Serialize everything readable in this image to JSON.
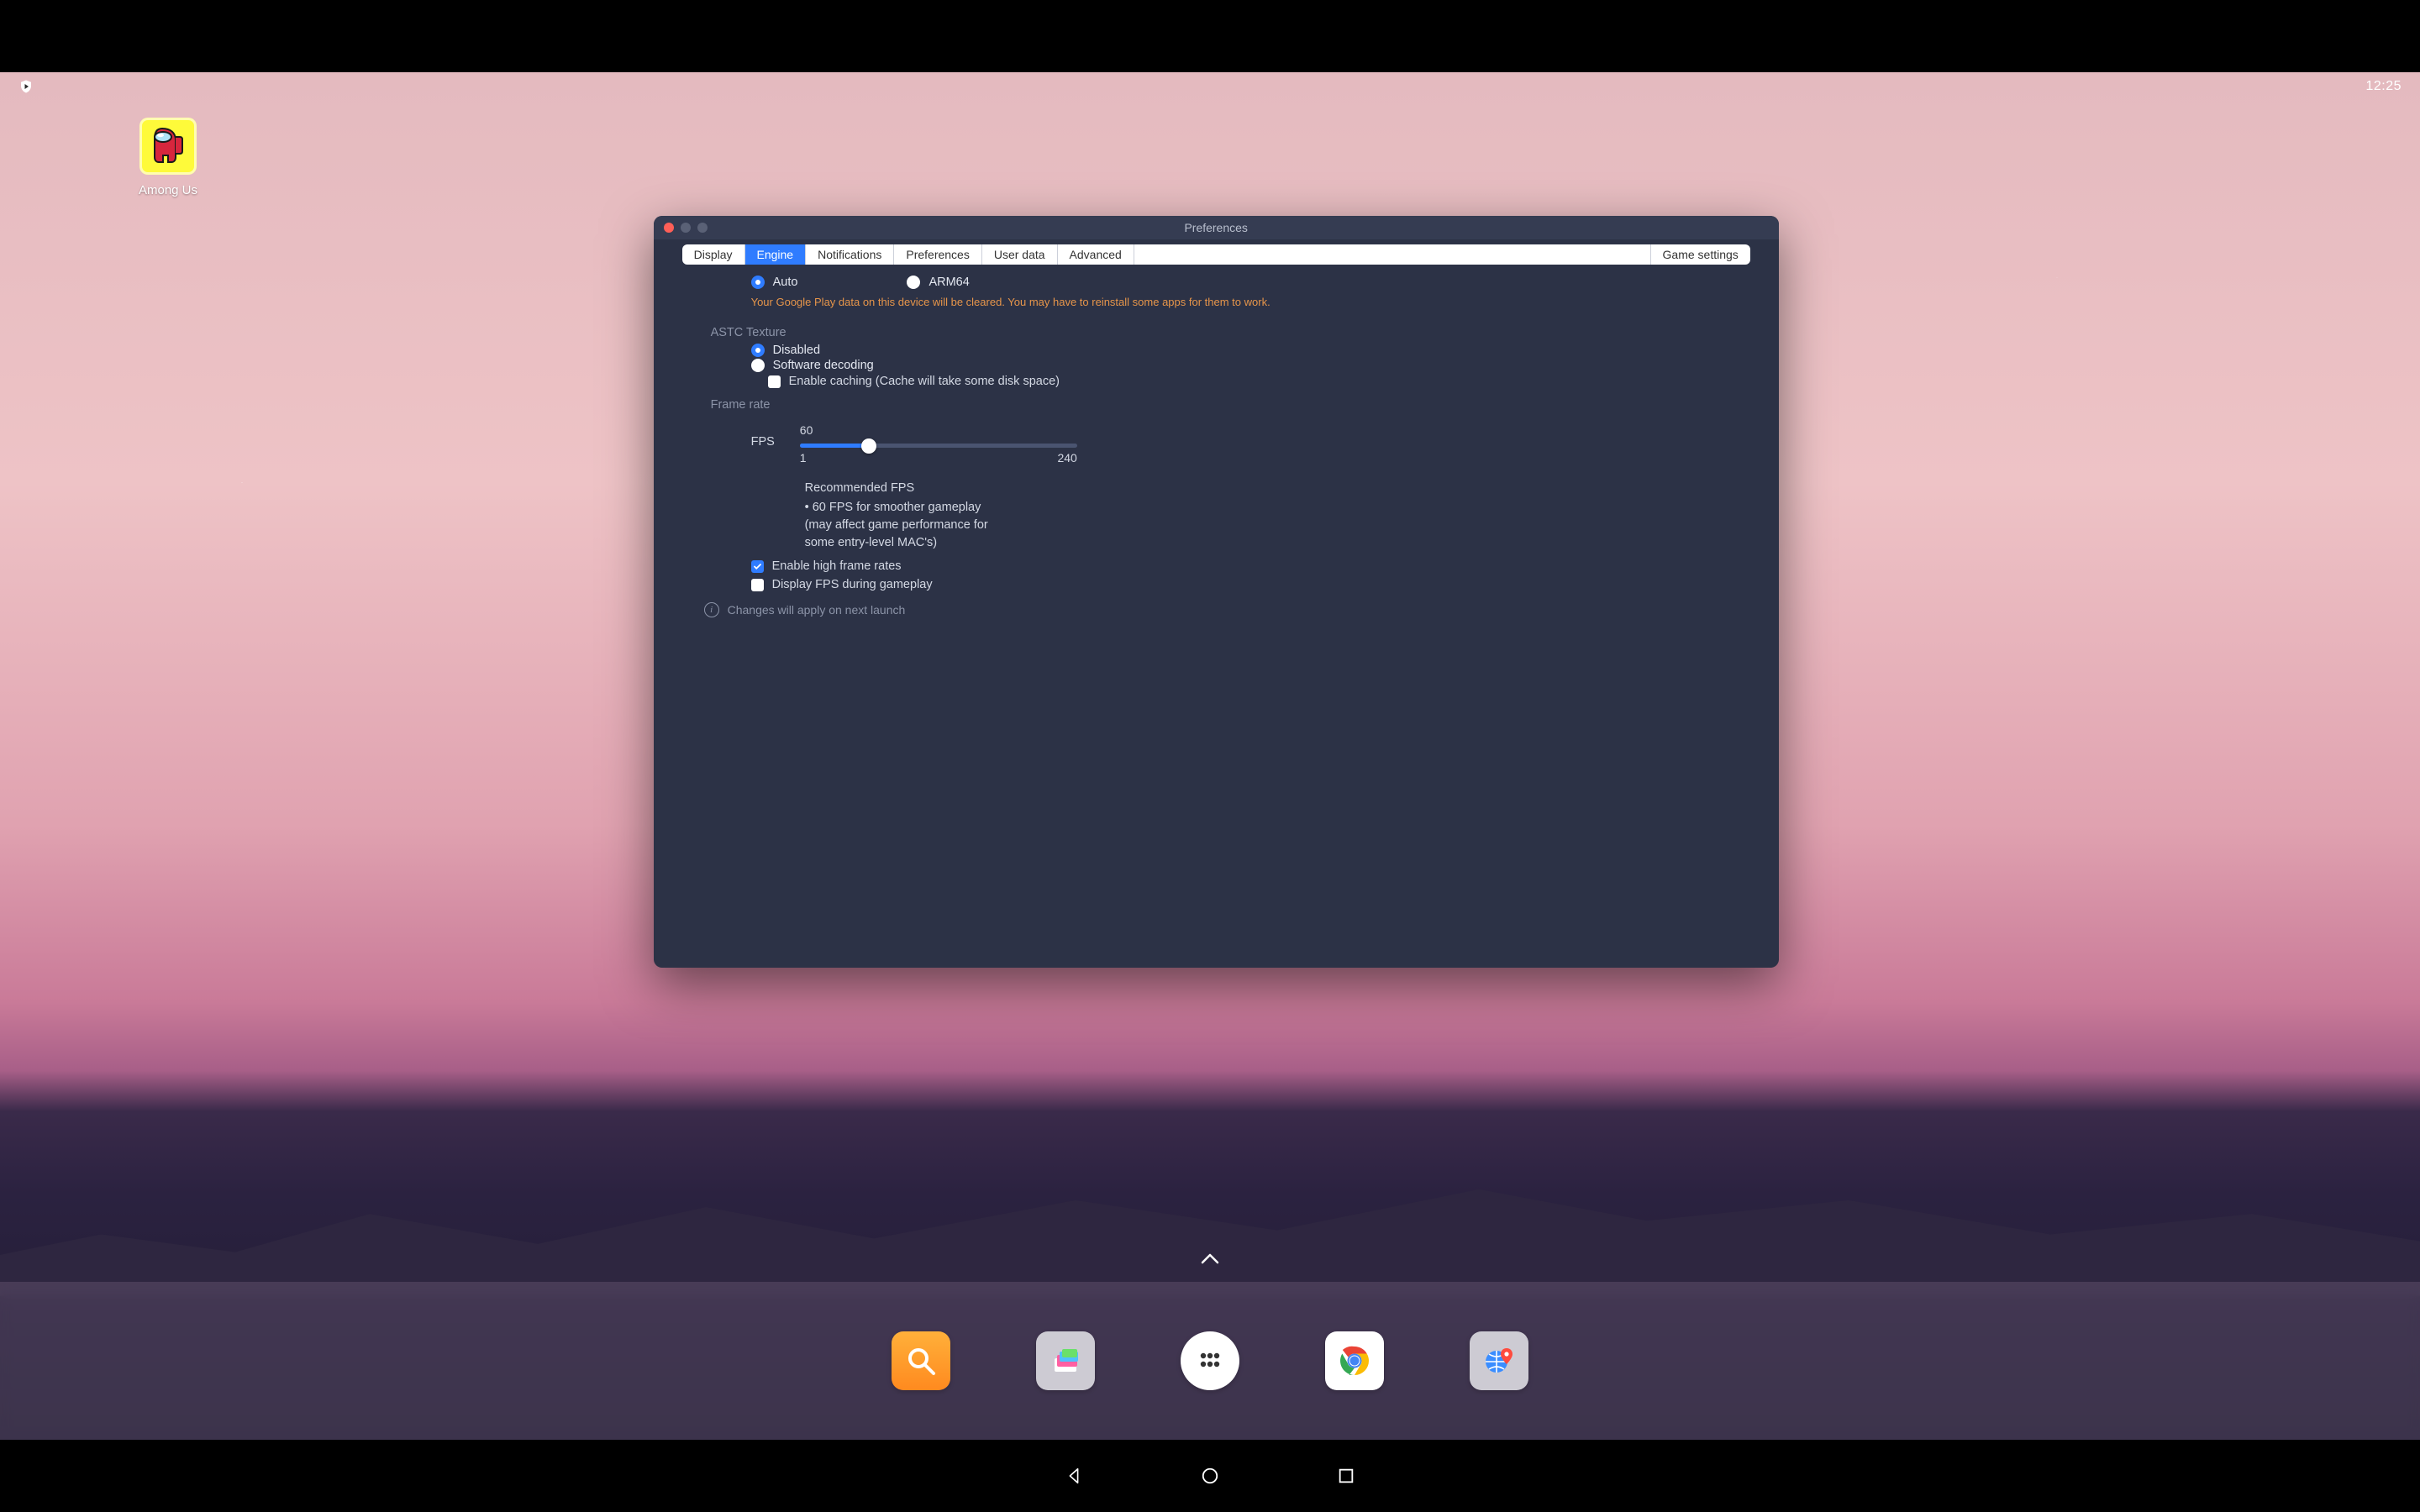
{
  "statusbar": {
    "clock": "12:25"
  },
  "desktop": {
    "apps": [
      {
        "label": "Among Us"
      }
    ]
  },
  "preferences": {
    "title": "Preferences",
    "tabs": [
      "Display",
      "Engine",
      "Notifications",
      "Preferences",
      "User data",
      "Advanced",
      "Game settings"
    ],
    "active_tab": "Engine",
    "engine": {
      "arch": {
        "options": [
          "Auto",
          "ARM64"
        ],
        "selected": "Auto",
        "warning": "Your Google Play data on this device will be cleared. You may have to reinstall some apps for them to work."
      },
      "astc": {
        "section_label": "ASTC Texture",
        "options": [
          "Disabled",
          "Software decoding"
        ],
        "selected": "Disabled",
        "enable_caching": {
          "checked": false,
          "label": "Enable caching (Cache will take some disk space)"
        }
      },
      "frame_rate": {
        "section_label": "Frame rate",
        "fps_label": "FPS",
        "value": 60,
        "min": 1,
        "max": 240,
        "recommended_heading": "Recommended FPS",
        "recommended_body": "• 60 FPS for smoother gameplay (may affect game performance for some entry-level MAC's)",
        "enable_high_fps": {
          "checked": true,
          "label": "Enable high frame rates"
        },
        "display_fps": {
          "checked": false,
          "label": "Display FPS during gameplay"
        }
      },
      "footer_note": "Changes will apply on next launch"
    }
  },
  "dock": {
    "items": [
      "search",
      "media-manager",
      "apps",
      "chrome",
      "maps"
    ]
  },
  "nav": {
    "buttons": [
      "back",
      "home",
      "recent"
    ]
  }
}
